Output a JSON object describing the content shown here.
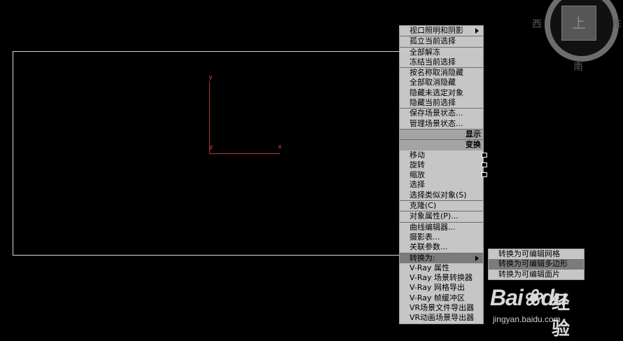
{
  "viewport": {
    "axes": {
      "y_label": "y",
      "z_label": "z",
      "x_label": "x"
    }
  },
  "viewcube": {
    "face": "上",
    "west": "西",
    "south": "南",
    "east": "东"
  },
  "menu": {
    "items": [
      {
        "label": "视口照明和阴影",
        "submenu": true
      },
      {
        "label": "孤立当前选择",
        "sep": true
      },
      {
        "label": "全部解冻",
        "sep": true
      },
      {
        "label": "冻结当前选择"
      },
      {
        "label": "按名称取消隐藏",
        "sep": true
      },
      {
        "label": "全部取消隐藏"
      },
      {
        "label": "隐藏未选定对象"
      },
      {
        "label": "隐藏当前选择"
      },
      {
        "label": "保存场景状态...",
        "sep": true
      },
      {
        "label": "管理场景状态..."
      },
      {
        "label": "显示",
        "header": true
      },
      {
        "label": "变换",
        "header": true
      },
      {
        "label": "移动",
        "checkbox": true
      },
      {
        "label": "旋转",
        "checkbox": true
      },
      {
        "label": "缩放",
        "checkbox": true
      },
      {
        "label": "选择"
      },
      {
        "label": "选择类似对象(S)"
      },
      {
        "label": "克隆(C)",
        "sep": true
      },
      {
        "label": "对象属性(P)...",
        "sep": true
      },
      {
        "label": "曲线编辑器...",
        "sep": true
      },
      {
        "label": "摄影表..."
      },
      {
        "label": "关联参数..."
      },
      {
        "label": "转换为:",
        "sep": true,
        "submenu": true,
        "active": true
      },
      {
        "label": "V-Ray 属性"
      },
      {
        "label": "V-Ray 场景转换器"
      },
      {
        "label": "V-Ray 网格导出"
      },
      {
        "label": "V-Ray 帧缓冲区"
      },
      {
        "label": "VR场景文件导出器"
      },
      {
        "label": "VR动画场景导出器"
      }
    ]
  },
  "submenu": {
    "items": [
      {
        "label": "转换为可编辑网格"
      },
      {
        "label": "转换为可编辑多边形",
        "highlight": true
      },
      {
        "label": "转换为可编辑面片"
      }
    ]
  },
  "watermark": {
    "logo": "Bai",
    "logo_suffix": "du",
    "cn": "经验",
    "url": "jingyan.baidu.com"
  }
}
